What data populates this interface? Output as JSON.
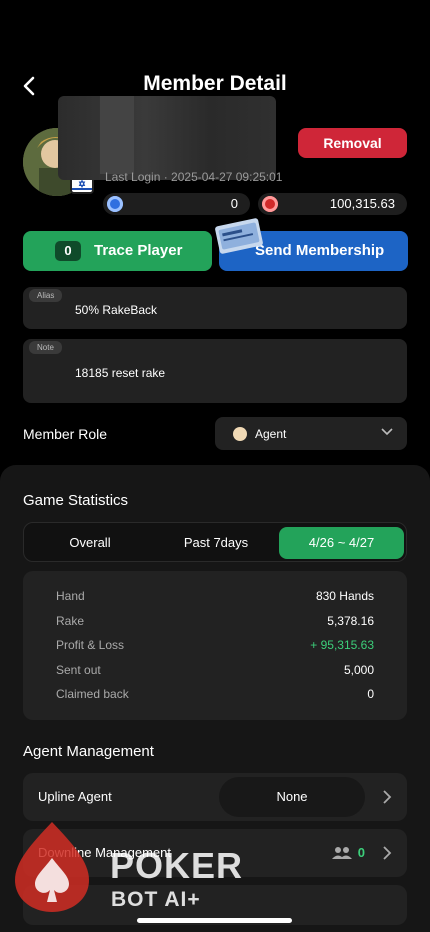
{
  "header": {
    "title": "Member Detail"
  },
  "member": {
    "last_login": "Last Login · 2025-04-27 09:25:01",
    "removal_label": "Removal",
    "chip_balance": "0",
    "coin_balance": "100,315.63"
  },
  "actions": {
    "trace_count": "0",
    "trace_label": "Trace Player",
    "send_label": "Send Membership"
  },
  "fields": {
    "alias_tag": "Alias",
    "alias_value": "50% RakeBack",
    "note_tag": "Note",
    "note_value": "18185 reset rake"
  },
  "role": {
    "label": "Member Role",
    "selected": "Agent"
  },
  "game_stats": {
    "title": "Game Statistics",
    "tabs": [
      "Overall",
      "Past 7days",
      "4/26 ~ 4/27"
    ],
    "active_tab": 2,
    "rows": [
      {
        "label": "Hand",
        "value": "830 Hands"
      },
      {
        "label": "Rake",
        "value": "5,378.16"
      },
      {
        "label": "Profit & Loss",
        "value": "+ 95,315.63"
      },
      {
        "label": "Sent out",
        "value": "5,000"
      },
      {
        "label": "Claimed back",
        "value": "0"
      }
    ]
  },
  "agent": {
    "title": "Agent Management",
    "upline_label": "Upline Agent",
    "upline_value": "None",
    "downline_label": "Downline Management",
    "downline_count": "0"
  },
  "watermark": {
    "line1": "POKER",
    "line2": "BOT AI+"
  },
  "colors": {
    "accent_green": "#23a35a",
    "danger_red": "#cf2638",
    "primary_blue": "#1d64c5",
    "profit_green": "#3ccf7a"
  }
}
